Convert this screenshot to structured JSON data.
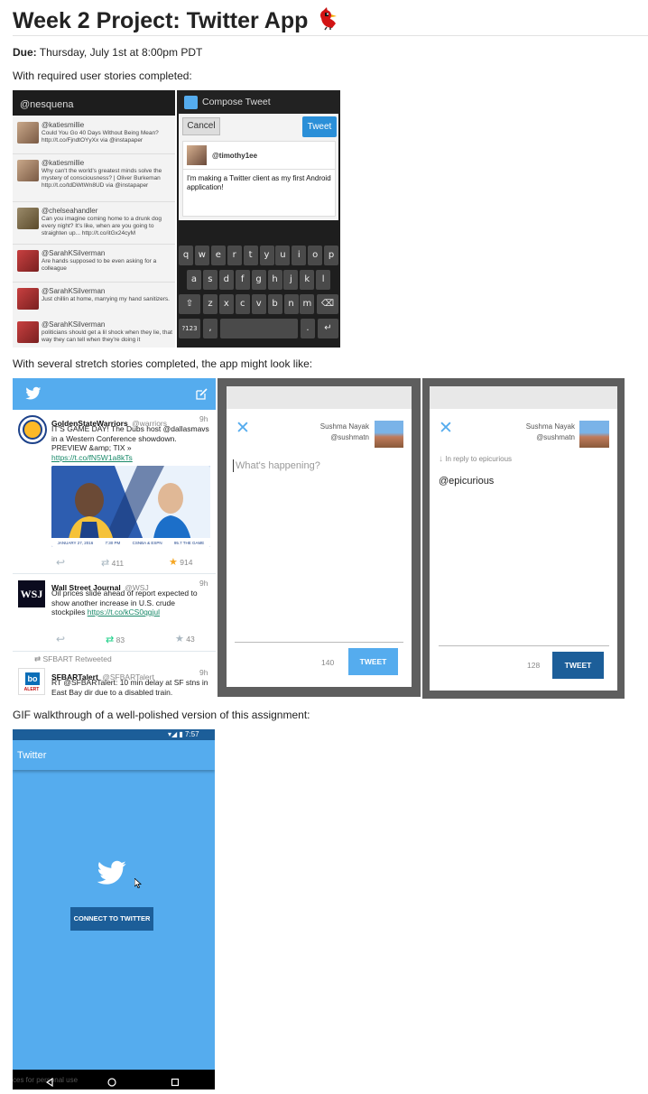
{
  "page": {
    "title": "Week 2 Project: Twitter App",
    "due_label": "Due:",
    "due_value": "Thursday, July 1st at 8:00pm PDT",
    "required_text": "With required user stories completed:",
    "stretch_text": "With several stretch stories completed, the app might look like:",
    "gif_text": "GIF walkthrough of a well-polished version of this assignment:"
  },
  "timeline1": {
    "header": "@nesquena",
    "items": [
      {
        "handle": "@katiesmillie",
        "text": "Could You Go 40 Days Without Being Mean? http://t.co/FjndtOYyXx via @instapaper"
      },
      {
        "handle": "@katiesmillie",
        "text": "Why can't the world's greatest minds solve the mystery of consciousness? | Oliver Burkeman http://t.co/tdDWtWn8UD via @instapaper"
      },
      {
        "handle": "@chelseahandler",
        "text": "Can you imagine coming home to a drunk dog every night? It's like, when are you going to straighten up... http://t.co/itGx24cyM"
      },
      {
        "handle": "@SarahKSilverman",
        "text": "Are hands supposed to be even asking for a colleague"
      },
      {
        "handle": "@SarahKSilverman",
        "text": "Just chillin at home, marrying my hand sanitizers."
      },
      {
        "handle": "@SarahKSilverman",
        "text": "politicians should get a lil shock when they lie, that way they can tell when they're doing it"
      }
    ]
  },
  "compose1": {
    "title": "Compose Tweet",
    "cancel": "Cancel",
    "tweet": "Tweet",
    "user": "@timothy1ee",
    "text": "I'm making a Twitter client as my first Android application!",
    "keys_row1": [
      "q",
      "w",
      "e",
      "r",
      "t",
      "y",
      "u",
      "i",
      "o",
      "p"
    ],
    "keys_row2": [
      "a",
      "s",
      "d",
      "f",
      "g",
      "h",
      "j",
      "k",
      "l"
    ],
    "keys_row3": [
      "z",
      "x",
      "c",
      "v",
      "b",
      "n",
      "m"
    ],
    "key_sym": "?123",
    "key_comma": ",",
    "key_period": "."
  },
  "stretch_timeline": {
    "tweets": [
      {
        "name": "GoldenStateWarriors",
        "handle": "@warriors",
        "time": "9h",
        "text": "IT'S GAME DAY! The Dubs host @dallasmavs in a Western Conference showdown. PREVIEW &amp; TIX »",
        "link": "https://t.co/fN5W1a8kTs",
        "retweets": "411",
        "likes": "914",
        "promo": [
          "JANUARY 27, 2016",
          "7:30 PM",
          "CSNBA & ESPN",
          "95.7 THE GAME"
        ]
      },
      {
        "name": "Wall Street Journal",
        "handle": "@WSJ",
        "time": "9h",
        "text": "Oil prices slide ahead of report expected to show another increase in U.S. crude stockpiles",
        "link": "https://t.co/kCS0qgjul",
        "retweets": "83",
        "likes": "43"
      },
      {
        "retweeted_by": "SFBART Retweeted",
        "name": "SFBARTalert",
        "handle": "@SFBARTalert",
        "time": "9h",
        "text": "RT @SFBARTalert: 10 min delay at SF stns in East Bay dir due to a disabled train.",
        "logo_text": "ALERT"
      }
    ]
  },
  "compose2": {
    "name": "Sushma Nayak",
    "handle": "@sushmatn",
    "placeholder": "What's happening?",
    "count": "140",
    "tweet": "TWEET"
  },
  "compose3": {
    "name": "Sushma Nayak",
    "handle": "@sushmatn",
    "reply_to": "In reply to epicurious",
    "text": "@epicurious",
    "count": "128",
    "tweet": "TWEET"
  },
  "login": {
    "status_time": "7:57",
    "app_title": "Twitter",
    "connect": "CONNECT TO TWITTER",
    "watermark": "ces for personal use"
  },
  "colors": {
    "twitter_blue": "#55acee",
    "tweet_button": "#1c5e99",
    "retweet_green": "#19cf86",
    "like_orange": "#f5a623"
  }
}
